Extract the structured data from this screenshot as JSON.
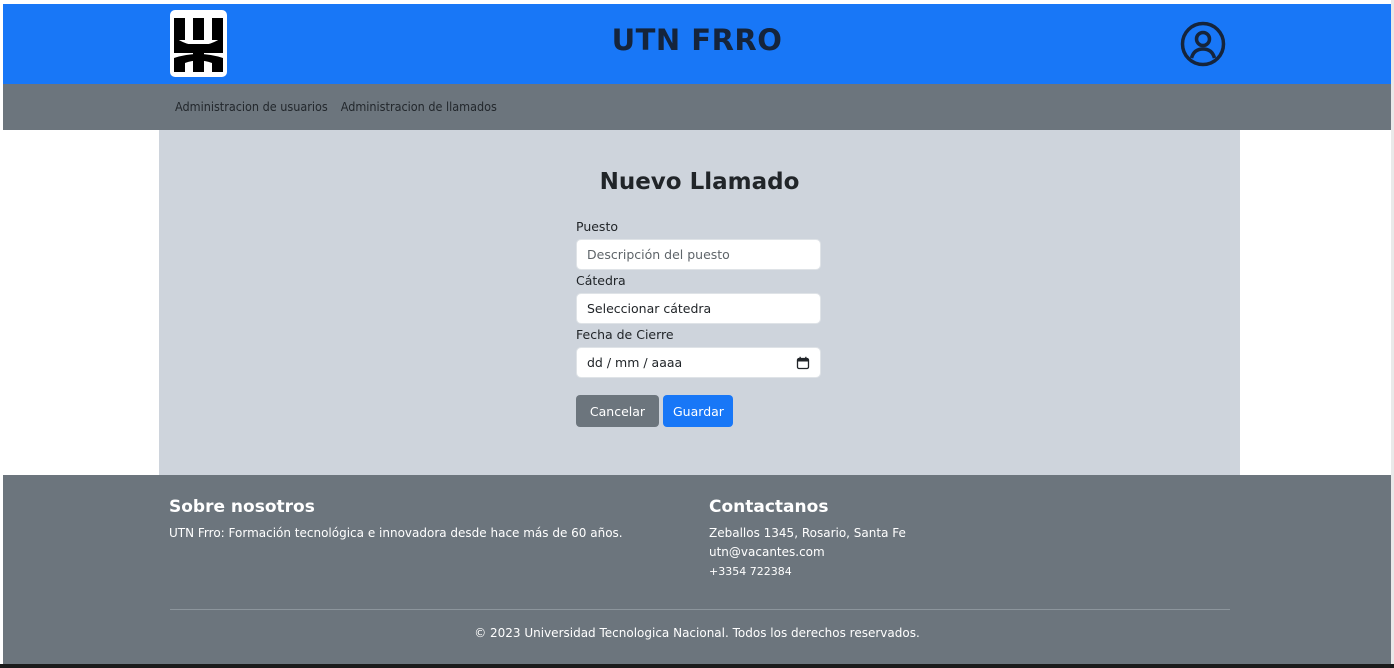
{
  "header": {
    "brand": "UTN FRRO",
    "logo_icon": "utn-logo-icon",
    "user_icon": "user-circle-icon",
    "primary_color": "#1877f7"
  },
  "nav": {
    "items": [
      {
        "label": "Administracion de usuarios"
      },
      {
        "label": "Administracion de llamados"
      }
    ]
  },
  "form": {
    "title": "Nuevo Llamado",
    "puesto": {
      "label": "Puesto",
      "placeholder": "Descripción del puesto"
    },
    "catedra": {
      "label": "Cátedra",
      "value": "Seleccionar cátedra"
    },
    "fecha": {
      "label": "Fecha de Cierre",
      "placeholder": "dd / mm / aaaa",
      "icon": "calendar-icon"
    },
    "cancel_label": "Cancelar",
    "save_label": "Guardar"
  },
  "footer": {
    "about": {
      "title": "Sobre nosotros",
      "text": "UTN Frro: Formación tecnológica e innovadora desde hace más de 60 años."
    },
    "contact": {
      "title": "Contactanos",
      "address": "Zeballos 1345, Rosario, Santa Fe",
      "email": "utn@vacantes.com",
      "phone": "+3354 722384"
    },
    "copyright": "© 2023 Universidad Tecnologica Nacional. Todos los derechos reservados."
  }
}
